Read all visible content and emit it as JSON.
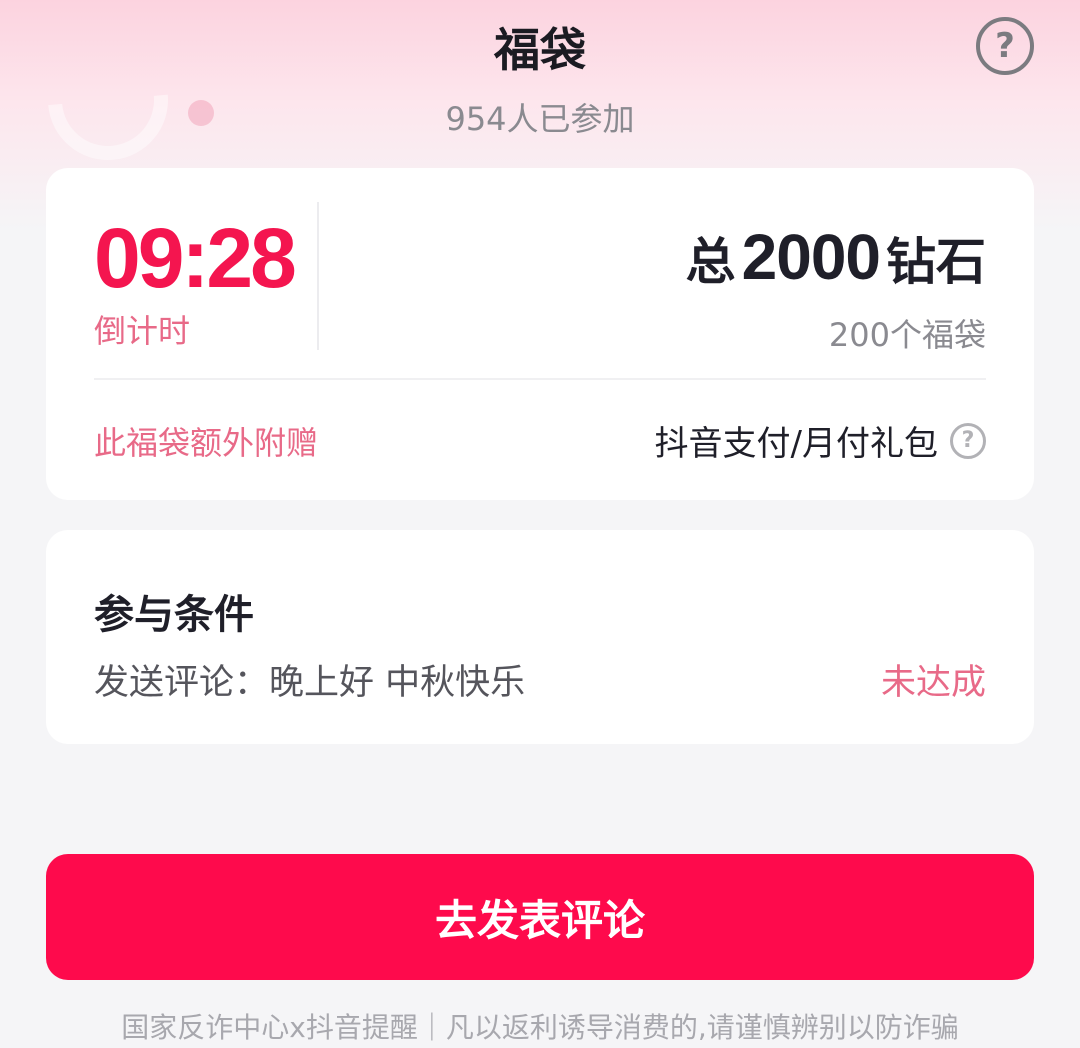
{
  "header": {
    "title": "福袋",
    "participants": "954人已参加",
    "help_icon": "question-circle-icon",
    "help_symbol": "?"
  },
  "prize_card": {
    "countdown": "09:28",
    "countdown_label": "倒计时",
    "prize_prefix": "总",
    "prize_amount": "2000",
    "prize_unit": "钻石",
    "bag_count": "200个福袋",
    "bonus_label": "此福袋额外附赠",
    "bonus_value": "抖音支付/月付礼包",
    "bonus_help_icon": "question-circle-icon",
    "bonus_help_symbol": "?"
  },
  "conditions": {
    "title": "参与条件",
    "requirement": "发送评论：晚上好 中秋快乐",
    "status": "未达成"
  },
  "cta": {
    "label": "去发表评论"
  },
  "footer": {
    "notice": "国家反诈中心x抖音提醒｜凡以返利诱导消费的,请谨慎辨别以防诈骗"
  },
  "colors": {
    "accent": "#fe0a4c",
    "countdown": "#f4154f",
    "pink_text": "#e86a88",
    "background": "#f5f5f7"
  }
}
